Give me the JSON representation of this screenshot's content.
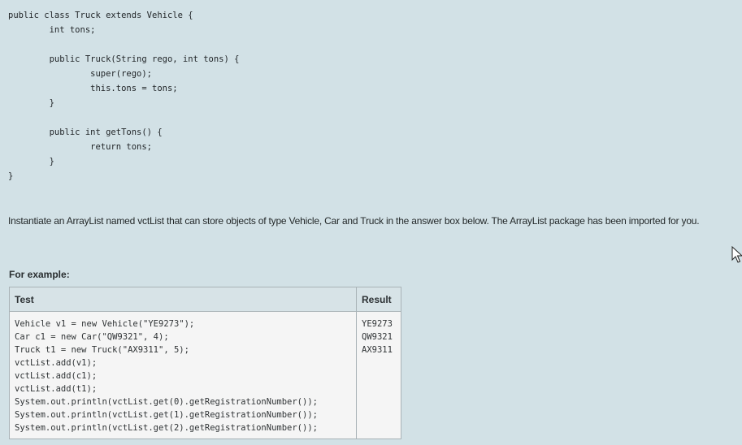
{
  "code_listing": {
    "lines": [
      "public class Truck extends Vehicle {",
      "        int tons;",
      "",
      "        public Truck(String rego, int tons) {",
      "                super(rego);",
      "                this.tons = tons;",
      "        }",
      "",
      "        public int getTons() {",
      "                return tons;",
      "        }",
      "}"
    ]
  },
  "instruction": "Instantiate an ArrayList named vctList that can store objects of type Vehicle, Car and Truck in the answer box below.  The ArrayList package has been imported for you.",
  "example": {
    "label": "For example:",
    "headers": {
      "test": "Test",
      "result": "Result"
    },
    "test_code": "Vehicle v1 = new Vehicle(\"YE9273\");\nCar c1 = new Car(\"QW9321\", 4);\nTruck t1 = new Truck(\"AX9311\", 5);\nvctList.add(v1);\nvctList.add(c1);\nvctList.add(t1);\nSystem.out.println(vctList.get(0).getRegistrationNumber());\nSystem.out.println(vctList.get(1).getRegistrationNumber());\nSystem.out.println(vctList.get(2).getRegistrationNumber());",
    "result_output": "YE9273\nQW9321\nAX9311"
  },
  "colors": {
    "page_background": "#d2e1e6",
    "table_header_background": "#d7e3e7",
    "table_cell_background": "#f5f5f5",
    "table_border": "#a9b3b7"
  },
  "icons": {
    "cursor": "mouse-pointer-icon"
  }
}
